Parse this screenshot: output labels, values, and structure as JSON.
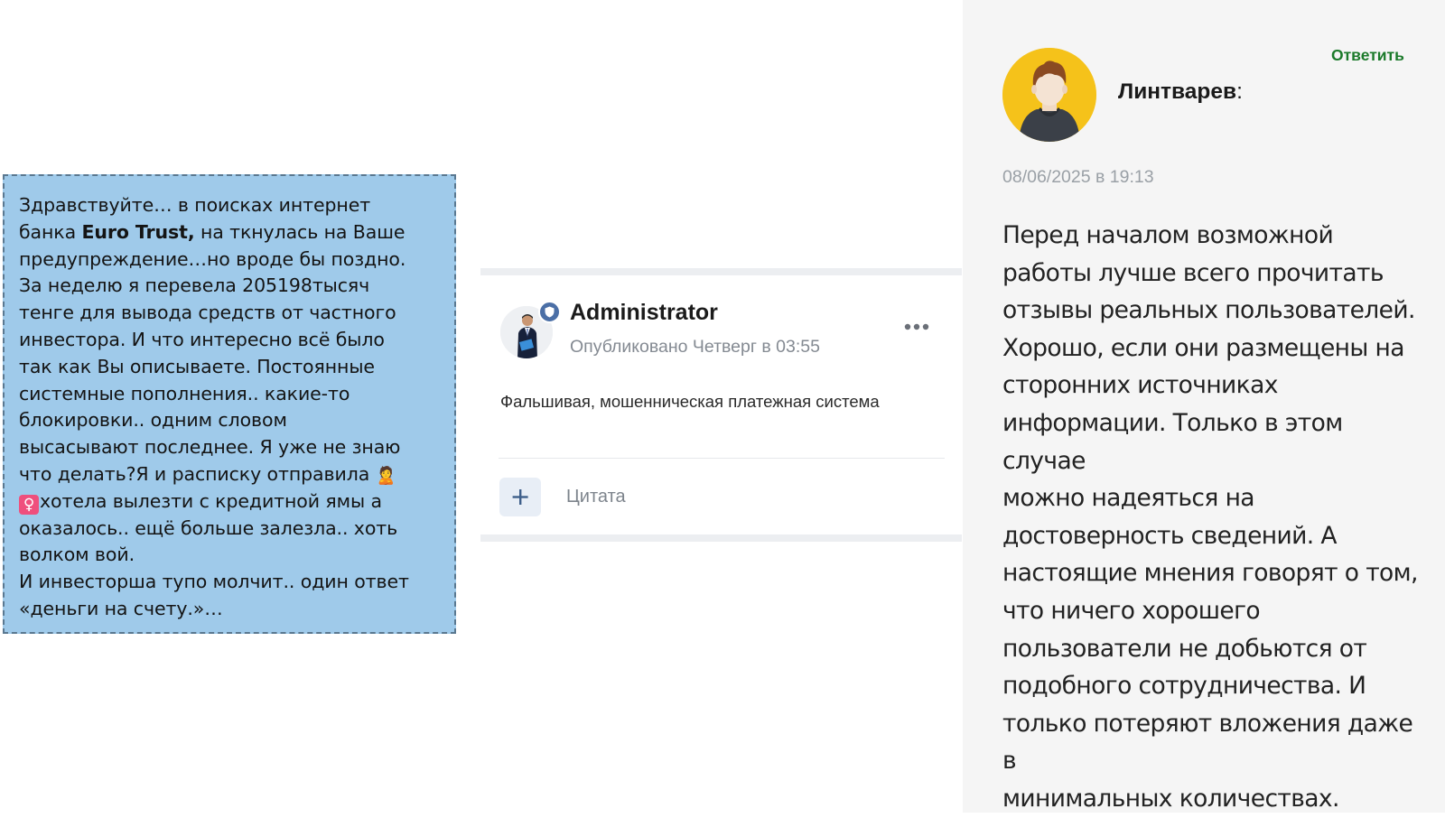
{
  "message_card": {
    "line1": "Здравствуйте… в поисках интернет",
    "line2_pre": "банка ",
    "line2_bold": "Euro Trust,",
    "line2_post": " на ткнулась на Ваше",
    "line3": "предупреждение…но вроде бы поздно.",
    "line4": "За неделю я перевела 205198тысяч",
    "line5": "тенге для вывода средств от частного",
    "line6": "инвестора. И что интересно всё было",
    "line7": "так как Вы описываете. Постоянные",
    "line8": "системные пополнения.. какие-то",
    "line9": "блокировки.. одним словом",
    "line10": "высасывают последнее. Я уже не знаю",
    "line11": "что делать?Я и расписку отправила",
    "line12": "хотела вылезти с кредитной ямы а",
    "line13": "оказалось.. ещё больше залезла.. хоть",
    "line14": "волком вой.",
    "line15": "И инвесторша тупо молчит.. один ответ",
    "line16": "«деньги на счету.»…",
    "emoji_girl": "🙎",
    "emoji_female": "♀"
  },
  "post": {
    "author": "Administrator",
    "meta": "Опубликовано Четверг в 03:55",
    "text": "Фальшивая, мошенническая платежная система",
    "plus": "+",
    "quote_label": "Цитата",
    "badge_icon": "shield-icon",
    "avatar_icon": "businessman-avatar"
  },
  "comment": {
    "author": "Линтварев",
    "colon": ":",
    "reply": "Ответить",
    "date": "08/06/2025 в 19:13",
    "text_lines": [
      "Перед началом возможной",
      "работы лучше всего прочитать",
      "отзывы реальных пользователей.",
      "Хорошо, если они размещены на",
      "сторонних источниках",
      "информации. Только в этом случае",
      "можно надеяться на",
      "достоверность сведений. А",
      "настоящие мнения говорят о том,",
      "что ничего хорошего",
      "пользователи не добьются от",
      "подобного сотрудничества. И",
      "только потеряют вложения даже в",
      "минимальных количествах."
    ],
    "avatar_icon": "user-avatar"
  },
  "colors": {
    "message_bg": "#9fcaea",
    "reply_green": "#1b7a2a",
    "badge_blue": "#4b6fa6",
    "avatar_yellow": "#f5c21a",
    "panel_bg": "#f5f5f5"
  }
}
